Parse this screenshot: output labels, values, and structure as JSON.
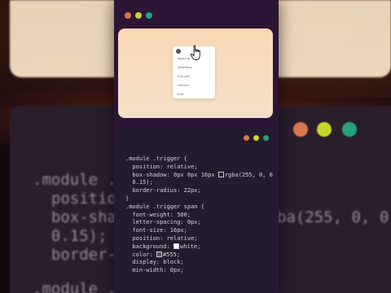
{
  "colors": {
    "dot_red": "#d9784b",
    "dot_yellow": "#c8d62a",
    "dot_green": "#27a17e",
    "code_text": "#d8d2de",
    "swatch_white": "#ffffff",
    "swatch_555": "#555555"
  },
  "preview": {
    "menu_items": [
      "Spacing",
      "Workflow",
      "Extrude",
      "Outline",
      "Edit"
    ]
  },
  "code": {
    "lines": [
      ".module .trigger {",
      "  position: relative;",
      "  box-shadow: 0px 0px 16px ",
      "  0.15);",
      "  border-radius: 22px;",
      "}",
      ".module .trigger span {",
      "  font-weight: 500;",
      "  letter-spacing: 0px;",
      "  font-size: 16px;",
      "  position: relative;",
      "  background: ",
      "  color: ",
      "  display: block;",
      "  min-width: 0px;"
    ],
    "shadow_value": "rgba(255, 0, 0",
    "background_value": "white;",
    "color_value": "#555;"
  },
  "background_text": {
    "lines": [
      ".module .tri",
      "  position",
      "  box-shado",
      "  0.15);",
      "  border-ra",
      ".module .t"
    ],
    "rgba_fragment": "ba(255, 0, 0"
  }
}
